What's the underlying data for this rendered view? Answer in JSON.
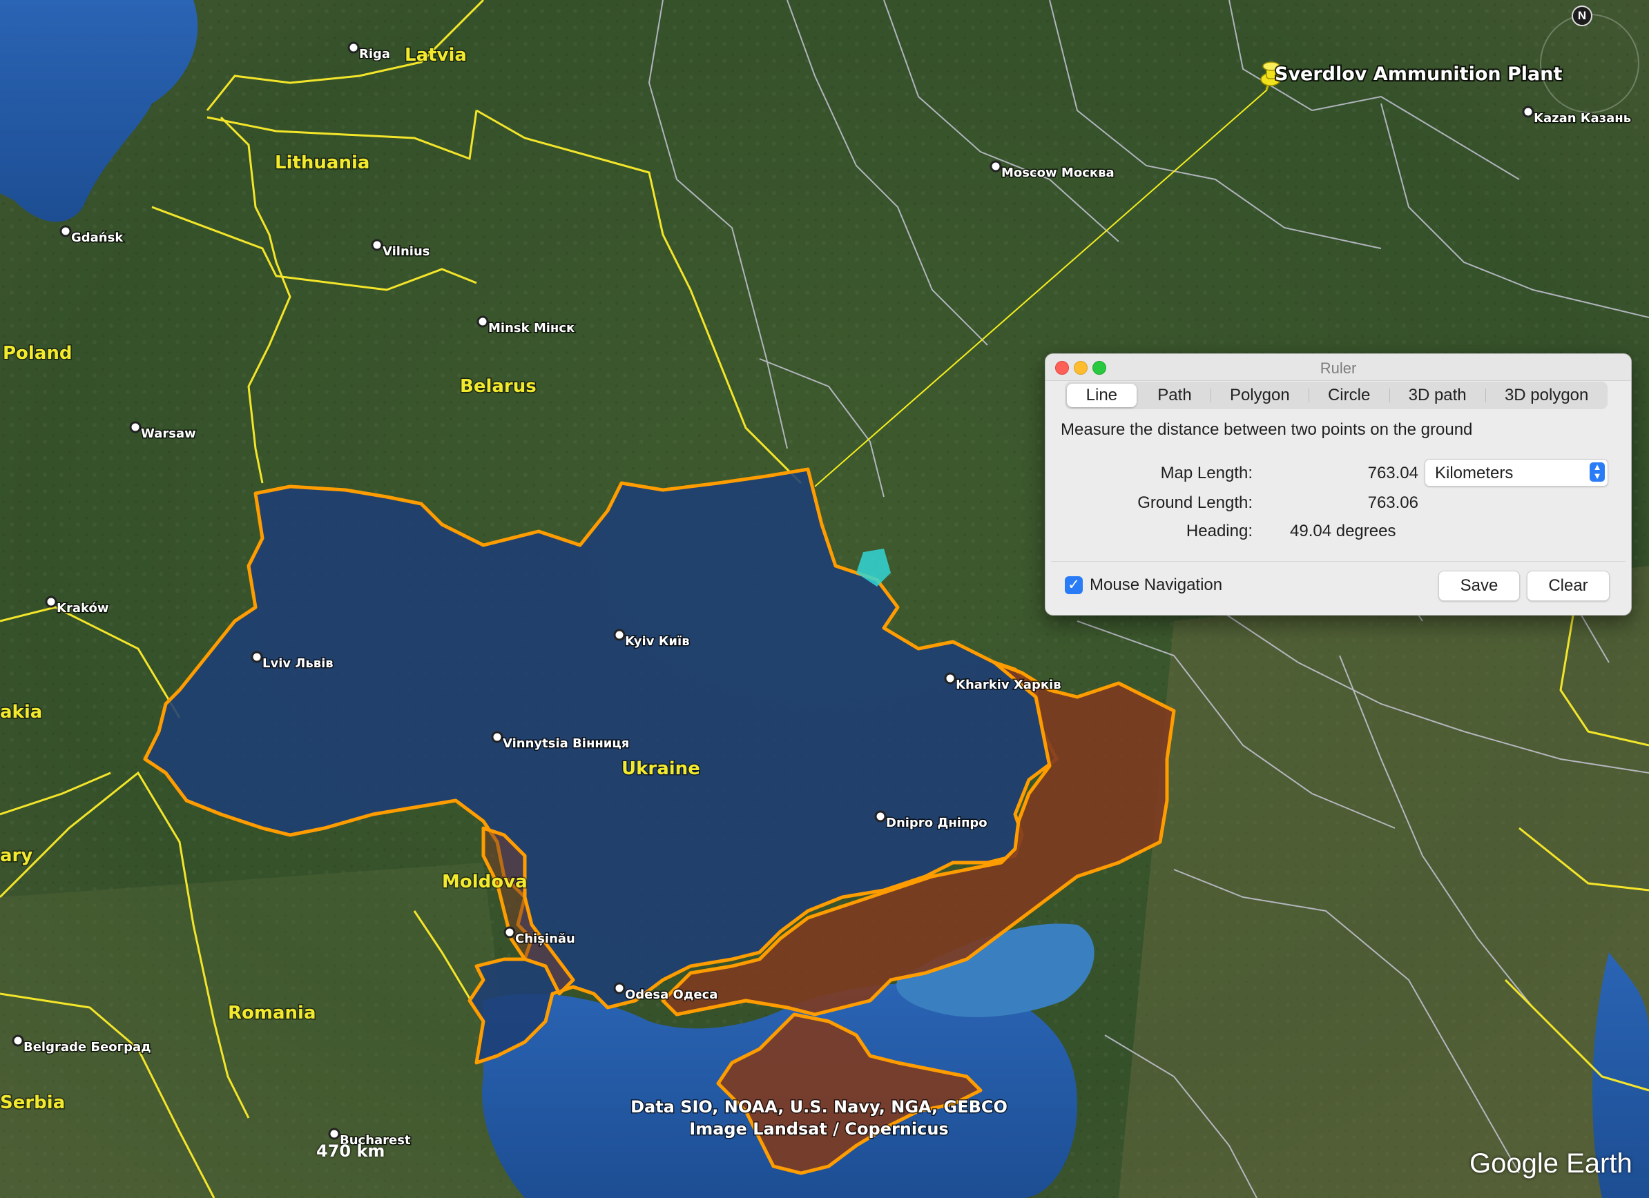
{
  "map": {
    "countries": [
      {
        "label": "Latvia"
      },
      {
        "label": "Lithuania"
      },
      {
        "label": "Poland"
      },
      {
        "label": "Belarus"
      },
      {
        "label": "Ukraine"
      },
      {
        "label": "Moldova"
      },
      {
        "label": "Romania"
      },
      {
        "label": "Serbia"
      },
      {
        "label": "akia"
      },
      {
        "label": "ary"
      }
    ],
    "cities": [
      {
        "label": "Riga"
      },
      {
        "label": "Gdańsk"
      },
      {
        "label": "Vilnius"
      },
      {
        "label": "Minsk Мінск"
      },
      {
        "label": "Warsaw"
      },
      {
        "label": "Kraków"
      },
      {
        "label": "Lviv Львів"
      },
      {
        "label": "Kyiv Київ"
      },
      {
        "label": "Vinnytsia Вінниця"
      },
      {
        "label": "Kharkiv Харків"
      },
      {
        "label": "Dnipro Дніпро"
      },
      {
        "label": "Chișinău"
      },
      {
        "label": "Odesa Одеса"
      },
      {
        "label": "Belgrade Београд"
      },
      {
        "label": "Bucharest"
      },
      {
        "label": "Moscow Москва"
      },
      {
        "label": "Kazan Казань"
      }
    ],
    "placemark": {
      "label": "Sverdlov Ammunition Plant",
      "icon": "pushpin-icon",
      "color": "#f2e21c"
    },
    "credits": [
      "Data SIO, NOAA, U.S. Navy, NGA, GEBCO",
      "Image Landsat / Copernicus"
    ],
    "scale_label": "470 km",
    "logo": "Google Earth",
    "compass_label": "N",
    "colors": {
      "ukraine_fill": "#1e3f75",
      "occupied_fill": "#7e3b20",
      "border_yellow": "#f3e52a",
      "border_orange": "#ff9d00",
      "region_border": "#c9c9d8",
      "sea": "#2d5fa6"
    }
  },
  "ruler": {
    "title": "Ruler",
    "tabs": [
      {
        "label": "Line",
        "active": true
      },
      {
        "label": "Path",
        "active": false
      },
      {
        "label": "Polygon",
        "active": false
      },
      {
        "label": "Circle",
        "active": false
      },
      {
        "label": "3D path",
        "active": false
      },
      {
        "label": "3D polygon",
        "active": false
      }
    ],
    "description": "Measure the distance between two points on the ground",
    "map_length_label": "Map Length:",
    "map_length_value": "763.04",
    "units": "Kilometers",
    "ground_length_label": "Ground Length:",
    "ground_length_value": "763.06",
    "heading_label": "Heading:",
    "heading_value": "49.04 degrees",
    "mouse_navigation_label": "Mouse Navigation",
    "mouse_navigation_checked": true,
    "save_label": "Save",
    "clear_label": "Clear"
  }
}
